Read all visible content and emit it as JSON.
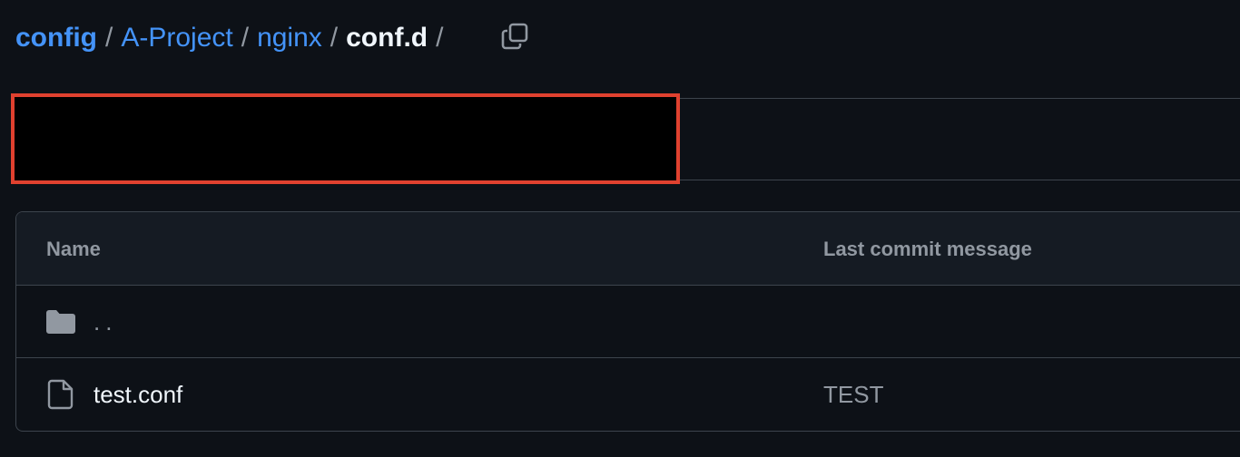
{
  "breadcrumb": {
    "items": [
      {
        "label": "config"
      },
      {
        "label": "A-Project"
      },
      {
        "label": "nginx"
      }
    ],
    "current": "conf.d",
    "separator": "/"
  },
  "icons": {
    "copy": "copy-icon",
    "folder": "folder-icon",
    "file": "file-icon"
  },
  "file_table": {
    "columns": {
      "name": "Name",
      "last_commit_message": "Last commit message"
    },
    "rows": [
      {
        "name": "..",
        "type": "parent-directory",
        "message": ""
      },
      {
        "name": "test.conf",
        "type": "file",
        "message": "TEST"
      }
    ]
  },
  "colors": {
    "background": "#0d1117",
    "link": "#4493f8",
    "muted": "#9198a1",
    "border": "#3d444d",
    "redaction_outline": "#e0412f"
  }
}
